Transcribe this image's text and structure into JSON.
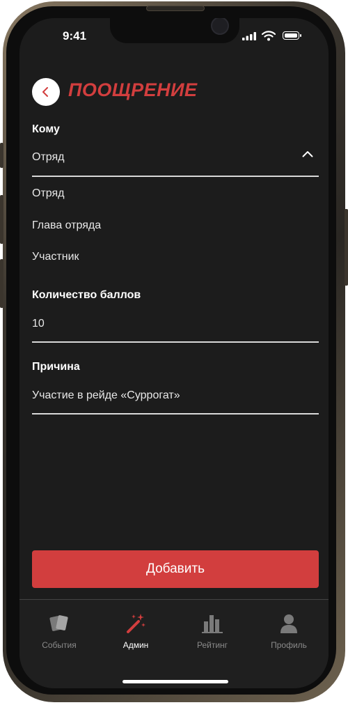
{
  "status": {
    "time": "9:41"
  },
  "header": {
    "title": "ПООЩРЕНИЕ"
  },
  "form": {
    "to": {
      "label": "Кому",
      "value": "Отряд",
      "options": [
        "Отряд",
        "Глава отряда",
        "Участник"
      ]
    },
    "points": {
      "label": "Количество баллов",
      "value": "10"
    },
    "reason": {
      "label": "Причина",
      "value": "Участие в рейде «Суррогат»"
    }
  },
  "submit_label": "Добавить",
  "tabs": [
    {
      "label": "События",
      "icon": "cards-icon",
      "active": false
    },
    {
      "label": "Админ",
      "icon": "magic-wand-icon",
      "active": true
    },
    {
      "label": "Рейтинг",
      "icon": "bar-chart-icon",
      "active": false
    },
    {
      "label": "Профиль",
      "icon": "profile-icon",
      "active": false
    }
  ],
  "colors": {
    "accent": "#d23e3e",
    "background": "#1c1c1c",
    "text": "#ffffff",
    "muted": "#8a8a8a"
  }
}
